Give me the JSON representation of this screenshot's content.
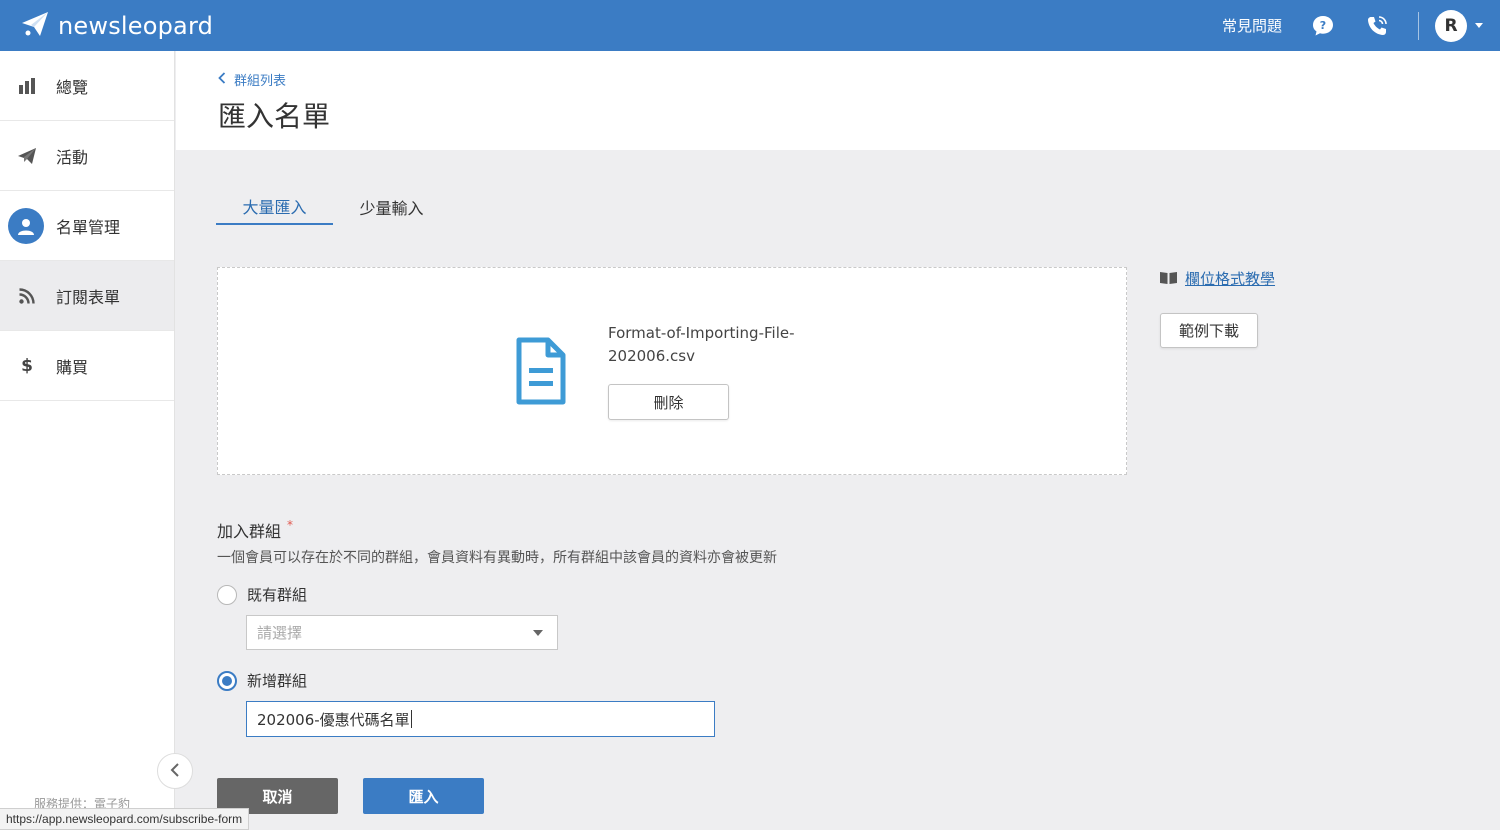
{
  "brand": {
    "name": "newsleopard"
  },
  "topbar": {
    "faq": "常見問題",
    "avatar_initial": "R"
  },
  "sidebar": {
    "items": [
      {
        "label": "總覽",
        "icon": "bar-chart-icon"
      },
      {
        "label": "活動",
        "icon": "paper-plane-icon"
      },
      {
        "label": "名單管理",
        "icon": "user-icon"
      },
      {
        "label": "訂閱表單",
        "icon": "rss-icon"
      },
      {
        "label": "購買",
        "icon": "dollar-icon"
      }
    ],
    "footer": "服務提供：電子豹"
  },
  "header": {
    "breadcrumb": "群組列表",
    "title": "匯入名單"
  },
  "tabs": [
    {
      "label": "大量匯入",
      "active": true
    },
    {
      "label": "少量輸入",
      "active": false
    }
  ],
  "upload": {
    "file_name_line1": "Format-of-Importing-File-",
    "file_name_line2": "202006.csv",
    "delete_label": "刪除"
  },
  "help": {
    "tutorial_link": "欄位格式教學",
    "sample_download": "範例下載"
  },
  "group": {
    "label": "加入群組",
    "required_mark": "*",
    "description": "一個會員可以存在於不同的群組，會員資料有異動時，所有群組中該會員的資料亦會被更新",
    "existing_option": "既有群組",
    "select_placeholder": "請選擇",
    "new_option": "新增群組",
    "new_group_value": "202006-優惠代碼名單"
  },
  "actions": {
    "cancel": "取消",
    "import": "匯入"
  },
  "status_bar": {
    "url": "https://app.newsleopard.com/subscribe-form"
  },
  "colors": {
    "primary": "#3b7cc4",
    "cancel": "#666666",
    "required": "#e0584e"
  }
}
